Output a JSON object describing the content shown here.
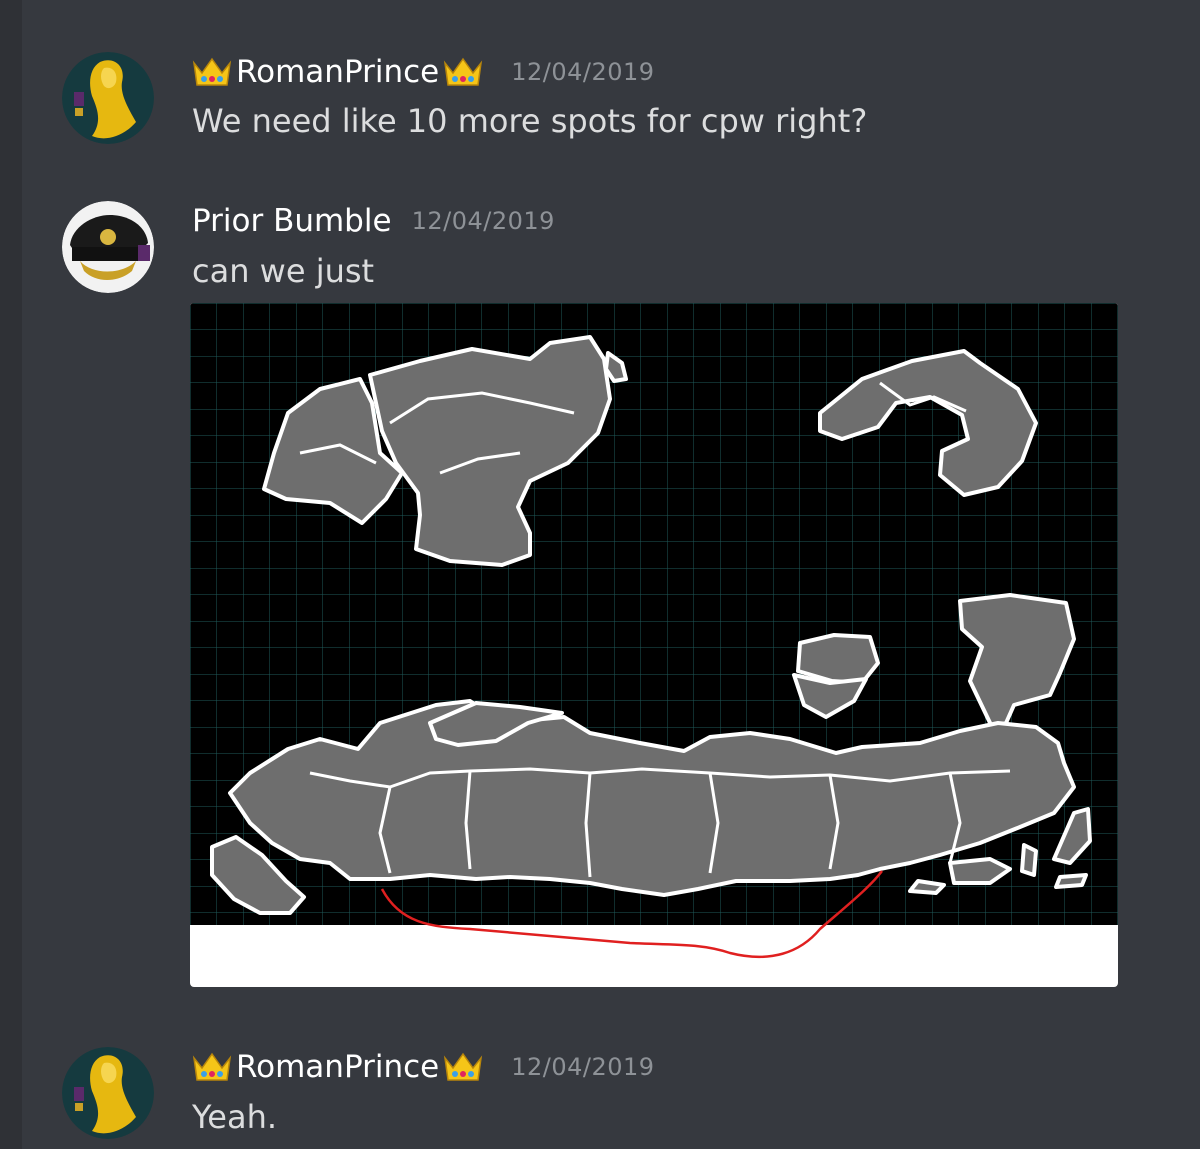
{
  "messages": [
    {
      "author": "RomanPrince",
      "author_crown": "crown-emoji",
      "timestamp": "12/04/2019",
      "text": "We need like 10 more spots for cpw right?"
    },
    {
      "author": "Prior Bumble",
      "timestamp": "12/04/2019",
      "text": "can we just",
      "attachment": {
        "kind": "image",
        "description_icon": "map-image",
        "annotation_color": "#e02020"
      }
    },
    {
      "author": "RomanPrince",
      "author_crown": "crown-emoji",
      "timestamp": "12/04/2019",
      "text": "Yeah."
    }
  ],
  "colors": {
    "background": "#36393f",
    "username": "#ffffff",
    "timestamp": "#8e9297",
    "message_text": "#dcddde",
    "map_land": "#6e6e6e",
    "map_grid": "#1f5a5a"
  }
}
